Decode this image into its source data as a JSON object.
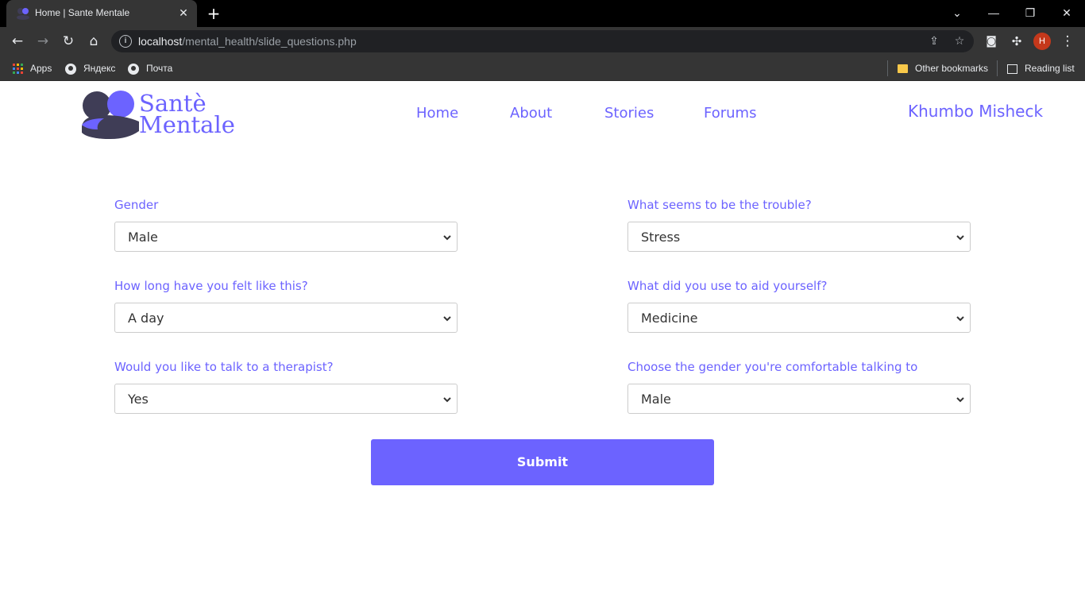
{
  "browser": {
    "tab_title": "Home | Sante Mentale",
    "url_host": "localhost",
    "url_path": "/mental_health/slide_questions.php",
    "profile_initial": "H",
    "bookmarks": {
      "apps": "Apps",
      "yandex": "Яндекс",
      "mail": "Почта",
      "other": "Other bookmarks",
      "reading": "Reading list"
    }
  },
  "site": {
    "logo_line1": "Santè",
    "logo_line2": "Mentale",
    "nav": [
      "Home",
      "About",
      "Stories",
      "Forums"
    ],
    "user_name": "Khumbo Misheck"
  },
  "form": {
    "gender": {
      "label": "Gender",
      "value": "Male"
    },
    "trouble": {
      "label": "What seems to be the trouble?",
      "value": "Stress"
    },
    "duration": {
      "label": "How long have you felt like this?",
      "value": "A day"
    },
    "aid": {
      "label": "What did you use to aid yourself?",
      "value": "Medicine"
    },
    "therapist": {
      "label": "Would you like to talk to a therapist?",
      "value": "Yes"
    },
    "therapist_gender": {
      "label": "Choose the gender you're comfortable talking to",
      "value": "Male"
    },
    "submit_label": "Submit"
  },
  "colors": {
    "accent": "#6c63ff",
    "logo_dark": "#3f3d56"
  }
}
